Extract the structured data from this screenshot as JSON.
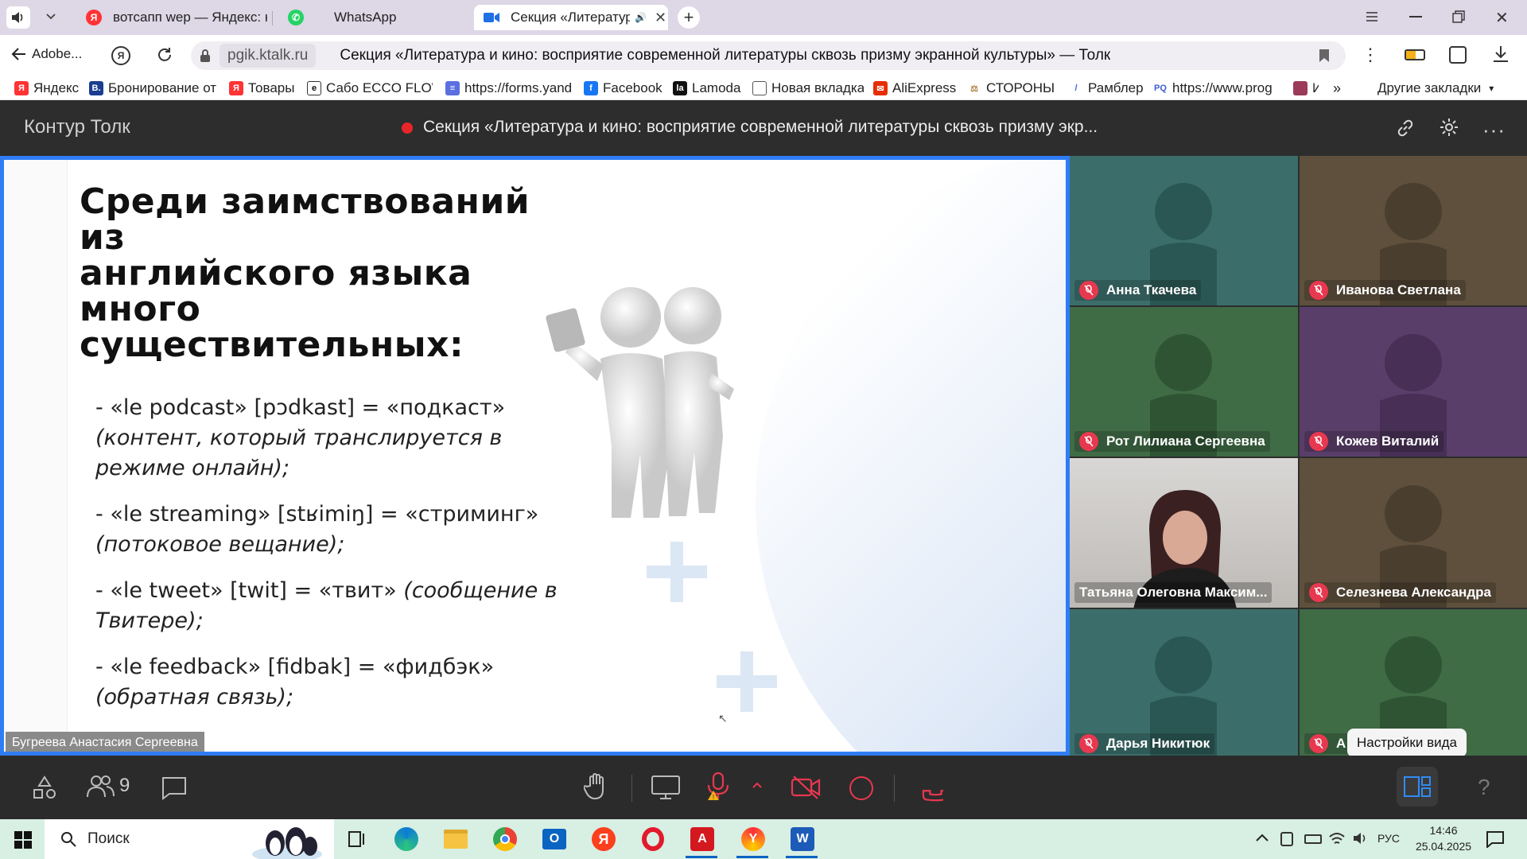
{
  "browser": {
    "tabs": [
      {
        "title": "вотсапп wep — Яндекс: на",
        "icon": "yandex-icon",
        "active": false
      },
      {
        "title": "WhatsApp",
        "icon": "whatsapp-icon",
        "active": false
      },
      {
        "title": "Секция «Литератур",
        "icon": "video-icon",
        "active": true
      }
    ],
    "back_label": "Adobe...",
    "url": "pgik.ktalk.ru",
    "page_title": "Секция «Литература и кино: восприятие современной литературы сквозь призму экранной культуры» — Толк",
    "bookmarks": [
      "Яндекс",
      "Бронирование от",
      "Товары",
      "Сабо ECCO FLOW",
      "https://forms.yand",
      "Facebook",
      "Lamoda",
      "Новая вкладка",
      "AliExpress",
      "СТОРОНЫ",
      "Рамблер",
      "https://www.prog",
      "И"
    ],
    "other_bookmarks": "Другие закладки"
  },
  "app": {
    "name": "Контур Толк",
    "meeting_title": "Секция «Литература и кино: восприятие современной литературы сквозь призму экр...",
    "recording_color": "#e8262a"
  },
  "slide": {
    "heading": [
      "Среди заимствований из",
      "английского языка много",
      "существительных:"
    ],
    "items": [
      {
        "text": "- «le podcast» [pɔdkast] = «подкаст»",
        "gloss": "(контент, который транслируется в режиме онлайн);"
      },
      {
        "text": "- «le streaming» [stʁimiŋ] = «стриминг»",
        "gloss": "(потоковое вещание);"
      },
      {
        "text": "- «le tweet» [twit] = «твит»",
        "gloss": "(сообщение в Твитере);"
      },
      {
        "text": "- «le feedback» [fidbak] = «фидбэк»",
        "gloss": "(обратная связь);"
      }
    ],
    "presenter": "Бугреева Анастасия Сергеевна"
  },
  "participants": [
    {
      "name": "Анна Ткачева",
      "color": "#3b6e6b",
      "muted": true
    },
    {
      "name": "Иванова Светлана",
      "color": "#5e503c",
      "muted": true
    },
    {
      "name": "Рот Лилиана Сергеевна",
      "color": "#3f6b45",
      "muted": true
    },
    {
      "name": "Кожев Виталий",
      "color": "#5a3e6a",
      "muted": true
    },
    {
      "name": "Татьяна Олеговна Максим...",
      "color": "#c8c6c4",
      "muted": false,
      "video": true
    },
    {
      "name": "Селезнева Александра",
      "color": "#5e503c",
      "muted": true
    },
    {
      "name": "Дарья Никитюк",
      "color": "#3b6e6b",
      "muted": true
    },
    {
      "name": "А",
      "color": "#3f6b45",
      "muted": true
    }
  ],
  "toolbar": {
    "participants_count": "9",
    "tooltip": "Настройки вида",
    "help": "?"
  },
  "taskbar": {
    "search": "Поиск",
    "lang": "РУС",
    "time": "14:46",
    "date": "25.04.2025"
  }
}
